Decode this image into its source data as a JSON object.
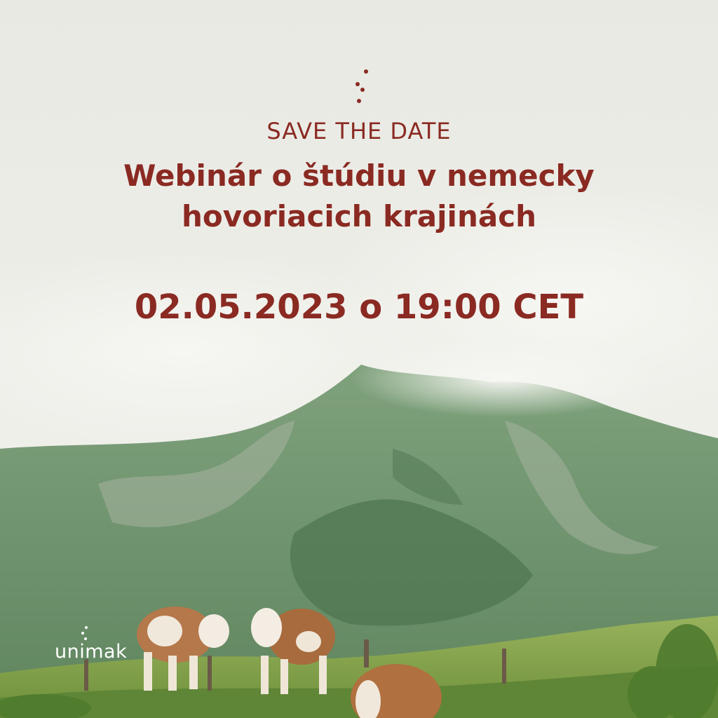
{
  "poster": {
    "eyebrow": "SAVE THE DATE",
    "title_line1": "Webinár o štúdiu v nemecky",
    "title_line2": "hovoriacich krajinách",
    "date": "02.05.2023 o 19:00 CET"
  },
  "brand": {
    "logo_text": "unimak"
  },
  "colors": {
    "accent": "#8a2a22",
    "sky": "#ebebe6",
    "mountain": "#6f9a6f",
    "grass": "#7ea04a"
  },
  "icons": {
    "dots": "three-dots-icon",
    "logo_mark": "logo-dots-icon"
  }
}
